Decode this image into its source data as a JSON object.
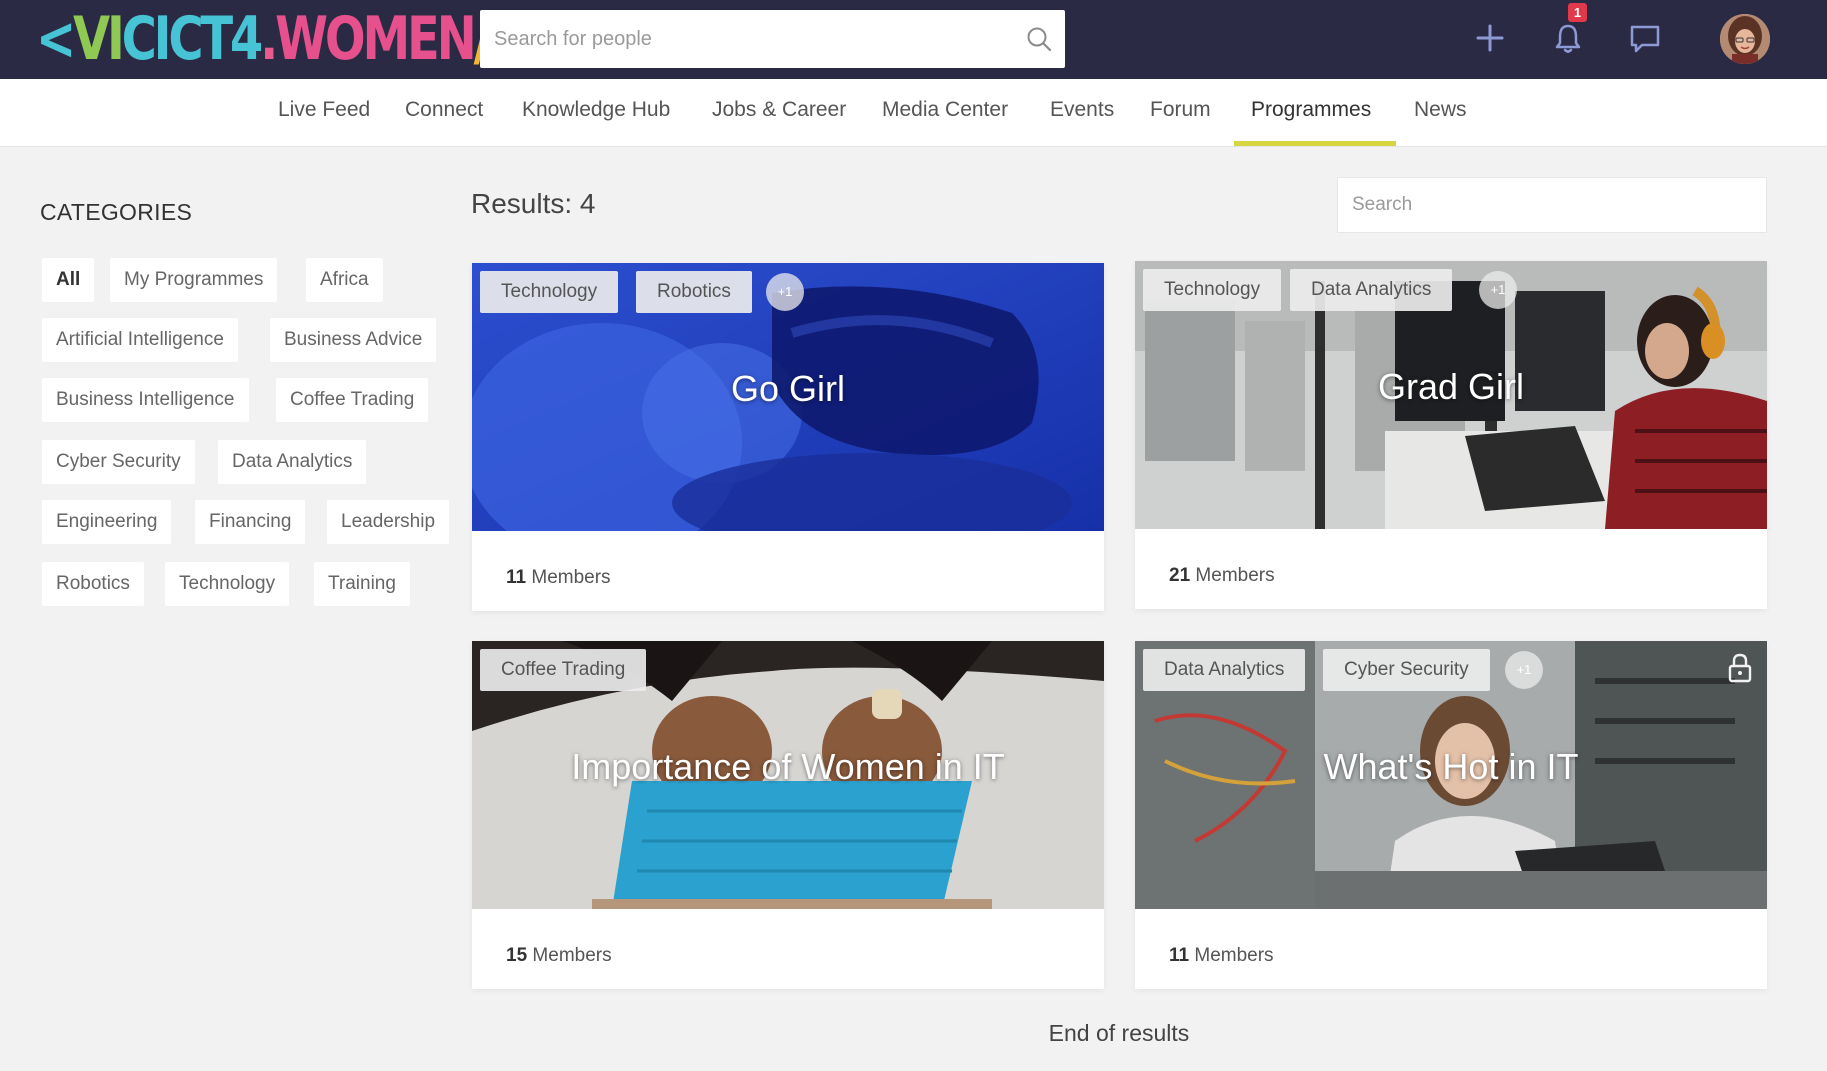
{
  "brand": {
    "logo_parts": [
      {
        "text": "<",
        "color": "#46c3d4"
      },
      {
        "text": "VI",
        "color": "#8fc954"
      },
      {
        "text": "CI",
        "color": "#46c3d4"
      },
      {
        "text": "CT4",
        "color": "#46c3d4"
      },
      {
        "text": ".",
        "color": "#e95b8f"
      },
      {
        "text": "WOMEN",
        "color": "#e6508c"
      },
      {
        "text": "/>",
        "color": "#f2b634"
      }
    ]
  },
  "header": {
    "search_placeholder": "Search for people",
    "notification_count": "1"
  },
  "nav": {
    "items": [
      {
        "label": "Live Feed"
      },
      {
        "label": "Connect"
      },
      {
        "label": "Knowledge Hub"
      },
      {
        "label": "Jobs & Career"
      },
      {
        "label": "Media Center"
      },
      {
        "label": "Events"
      },
      {
        "label": "Forum"
      },
      {
        "label": "Programmes",
        "active": true
      },
      {
        "label": "News"
      }
    ]
  },
  "categories": {
    "title": "CATEGORIES",
    "items": [
      "All",
      "My Programmes",
      "Africa",
      "Artificial Intelligence",
      "Business Advice",
      "Business Intelligence",
      "Coffee Trading",
      "Cyber Security",
      "Data Analytics",
      "Engineering",
      "Financing",
      "Leadership",
      "Robotics",
      "Technology",
      "Training"
    ],
    "selected": "All"
  },
  "results": {
    "label": "Results: 4",
    "search_placeholder": "Search",
    "end_label": "End of results"
  },
  "programmes": [
    {
      "title": "Go Girl",
      "tags": [
        "Technology",
        "Robotics"
      ],
      "more": "+1",
      "members_count": "11",
      "members_label": "Members",
      "locked": false
    },
    {
      "title": "Grad Girl",
      "tags": [
        "Technology",
        "Data Analytics"
      ],
      "more": "+1",
      "members_count": "21",
      "members_label": "Members",
      "locked": false
    },
    {
      "title": "Importance of Women in IT",
      "tags": [
        "Coffee Trading"
      ],
      "more": "",
      "members_count": "15",
      "members_label": "Members",
      "locked": false
    },
    {
      "title": "What's Hot in IT",
      "tags": [
        "Data Analytics",
        "Cyber Security"
      ],
      "more": "+1",
      "members_count": "11",
      "members_label": "Members",
      "locked": true
    }
  ],
  "colors": {
    "topbar": "#2b2a44",
    "active_underline": "#d8d640",
    "badge": "#e2384b"
  }
}
